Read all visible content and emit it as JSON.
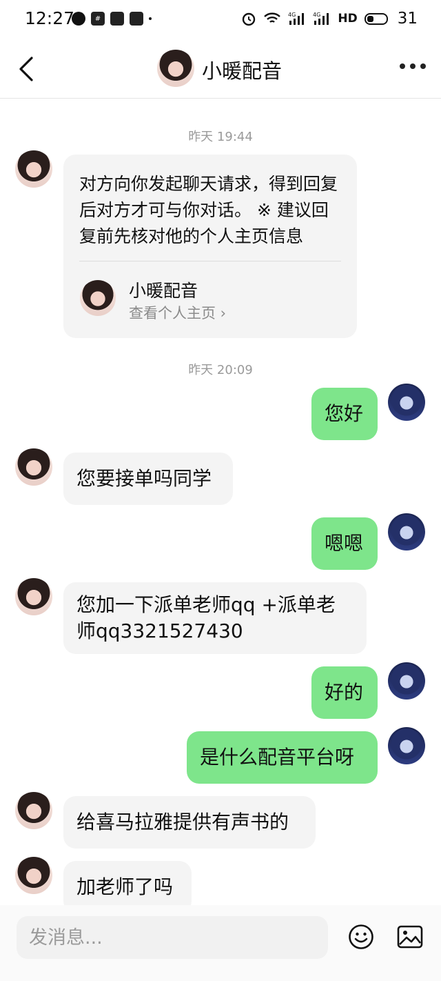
{
  "status_bar": {
    "time": "12:27",
    "network_badges": [
      "4G",
      "4G"
    ],
    "hd_label": "HD",
    "battery_percent": "31"
  },
  "header": {
    "title": "小暖配音"
  },
  "messages": {
    "ts1": "昨天 19:44",
    "card_text": "对方向你发起聊天请求，得到回复后对方才可与你对话。 ※ 建议回复前先核对他的个人主页信息",
    "card_name": "小暖配音",
    "card_link": "查看个人主页 ›",
    "ts2": "昨天 20:09",
    "m1": "您好",
    "m2": "您要接单吗同学",
    "m3": "嗯嗯",
    "m4": "您加一下派单老师qq +派单老师qq3321527430",
    "m5": "好的",
    "m6": "是什么配音平台呀",
    "m7": "给喜马拉雅提供有声书的",
    "m8": "加老师了吗"
  },
  "input": {
    "placeholder": "发消息..."
  },
  "colors": {
    "outgoing_bubble": "#7ee58b",
    "incoming_bubble": "#f4f4f4"
  }
}
